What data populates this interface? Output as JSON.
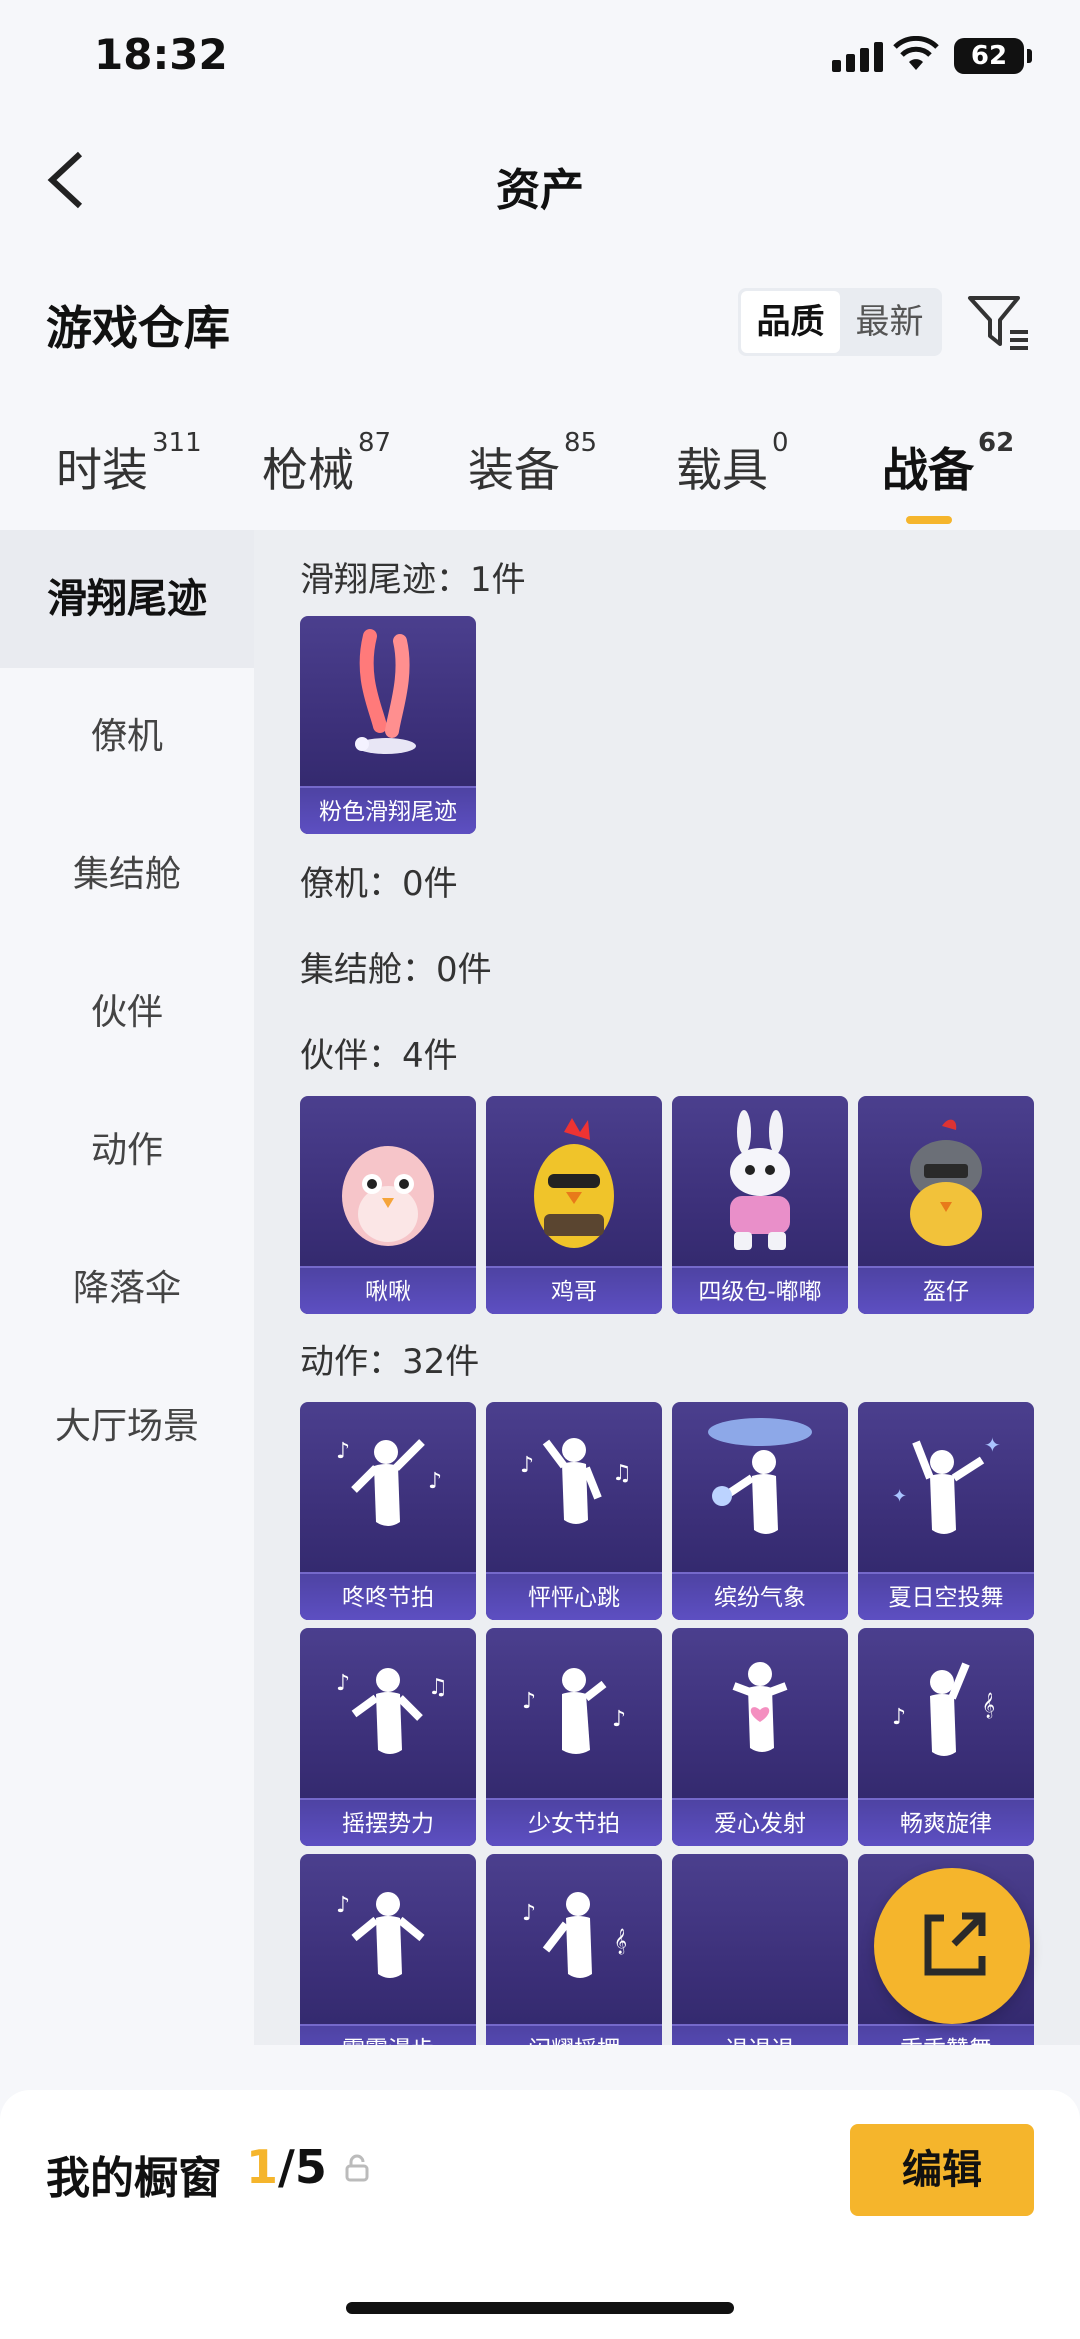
{
  "status": {
    "time": "18:32",
    "battery": "62"
  },
  "nav": {
    "title": "资产"
  },
  "header": {
    "title": "游戏仓库",
    "sort_options": [
      "品质",
      "最新"
    ]
  },
  "tabs": [
    {
      "label": "时装",
      "count": "311"
    },
    {
      "label": "枪械",
      "count": "87"
    },
    {
      "label": "装备",
      "count": "85"
    },
    {
      "label": "载具",
      "count": "0"
    },
    {
      "label": "战备",
      "count": "62"
    }
  ],
  "sidebar": [
    "滑翔尾迹",
    "僚机",
    "集结舱",
    "伙伴",
    "动作",
    "降落伞",
    "大厅场景"
  ],
  "sections": {
    "glide": {
      "title": "滑翔尾迹：1件",
      "items": [
        "粉色滑翔尾迹"
      ]
    },
    "wingman": {
      "title": "僚机：0件"
    },
    "pod": {
      "title": "集结舱：0件"
    },
    "partner": {
      "title": "伙伴：4件",
      "items": [
        "啾啾",
        "鸡哥",
        "四级包-嘟嘟",
        "盔仔"
      ]
    },
    "emote": {
      "title": "动作：32件",
      "items": [
        "咚咚节拍",
        "怦怦心跳",
        "缤纷气象",
        "夏日空投舞",
        "摇摆势力",
        "少女节拍",
        "爱心发射",
        "畅爽旋律",
        "霹雳漫步",
        "闪耀摇摆",
        "退退退",
        "乖乖赞舞"
      ]
    }
  },
  "showcase": {
    "title": "我的橱窗",
    "current": "1",
    "total": "/5",
    "edit_label": "编辑"
  },
  "colors": {
    "accent": "#f5b52c",
    "card": "#3b2f78"
  }
}
